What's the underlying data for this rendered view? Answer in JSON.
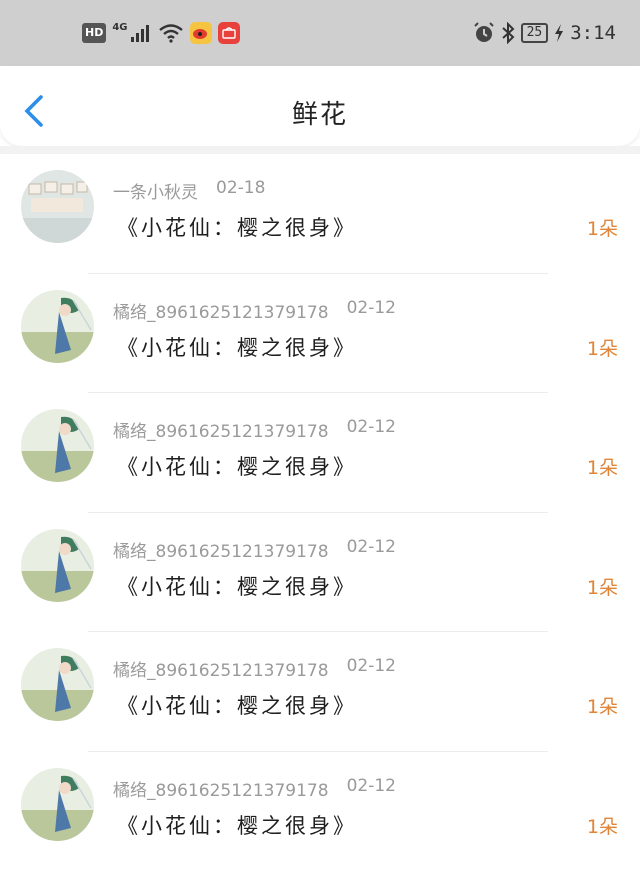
{
  "status_bar": {
    "hd": "HD",
    "network": "4G",
    "battery": "25",
    "time": "3:14"
  },
  "header": {
    "title": "鲜花",
    "back_icon": "chevron-left-icon"
  },
  "colors": {
    "accent_blue": "#2b8ee8",
    "quantity_orange": "#e0853a",
    "status_bar_bg": "#cfcfcf"
  },
  "records": [
    {
      "user": "一条小秋灵",
      "date": "02-18",
      "gift": "《小花仙：樱之很身》",
      "quantity": "1朵",
      "avatar": "toy-blocks-avatar"
    },
    {
      "user": "橘络_8961625121379178",
      "date": "02-12",
      "gift": "《小花仙：樱之很身》",
      "quantity": "1朵",
      "avatar": "anime-figure-avatar"
    },
    {
      "user": "橘络_8961625121379178",
      "date": "02-12",
      "gift": "《小花仙：樱之很身》",
      "quantity": "1朵",
      "avatar": "anime-figure-avatar"
    },
    {
      "user": "橘络_8961625121379178",
      "date": "02-12",
      "gift": "《小花仙：樱之很身》",
      "quantity": "1朵",
      "avatar": "anime-figure-avatar"
    },
    {
      "user": "橘络_8961625121379178",
      "date": "02-12",
      "gift": "《小花仙：樱之很身》",
      "quantity": "1朵",
      "avatar": "anime-figure-avatar"
    },
    {
      "user": "橘络_8961625121379178",
      "date": "02-12",
      "gift": "《小花仙：樱之很身》",
      "quantity": "1朵",
      "avatar": "anime-figure-avatar"
    }
  ]
}
